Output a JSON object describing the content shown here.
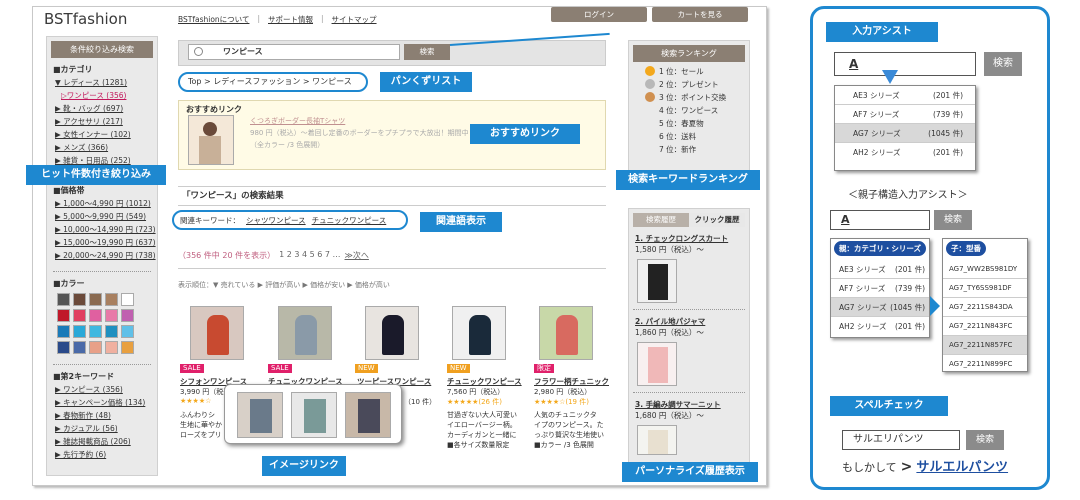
{
  "site": {
    "logo": "BSTfashion",
    "nav": [
      "BSTfashionについて",
      "サポート情報",
      "サイトマップ"
    ],
    "login": "ログイン",
    "cart": "カートを見る"
  },
  "left": {
    "filter_title": "条件絞り込み検索",
    "category_title": "■カテゴリ",
    "categories": [
      "▼ レディース (1281)",
      "▷ワンピース (356)",
      "▶ 靴・バッグ (697)",
      "▶ アクセサリ (217)",
      "▶ 女性インナー (102)",
      "▶ メンズ (366)",
      "▶ 雑貨・日用品 (252)"
    ],
    "price_title": "■価格帯",
    "prices": [
      "▶ 1,000〜4,990 円 (1012)",
      "▶ 5,000〜9,990 円 (549)",
      "▶ 10,000〜14,990 円 (723)",
      "▶ 15,000〜19,990 円 (637)",
      "▶ 20,000〜24,990 円 (738)"
    ],
    "color_title": "■カラー",
    "colors": [
      "#555",
      "#6b4a3a",
      "#8a6a50",
      "#a88060",
      "#fff",
      "#c0182a",
      "#e04060",
      "#e060a0",
      "#e87aa8",
      "#c060b0",
      "#1a7ab8",
      "#2aa8d8",
      "#40b8e0",
      "#2090c0",
      "#60c0e8",
      "#2a4a8a",
      "#4a6aa8",
      "#e8a088",
      "#f0b0a0",
      "#e8a040"
    ],
    "kw2_title": "■第2キーワード",
    "kw2": [
      "▶ ワンピース (356)",
      "▶ キャンペーン価格 (134)",
      "▶ 春物新作 (48)",
      "▶ カジュアル (56)",
      "▶ 雑誌掲載商品 (206)",
      "▶ 先行予約 (6)"
    ]
  },
  "search": {
    "query": "ワンピース",
    "button": "検索"
  },
  "breadcrumb": "Top > レディースファッション > ワンピース",
  "rec": {
    "title": "おすすめリンク",
    "link": "くつろぎボーダー長袖Tシャツ",
    "desc": "980 円（税込）〜着回し定番のボーダーをプチプラで大放出！期間中",
    "sub": "（全カラー /3 色展開）"
  },
  "results": {
    "title": "「ワンピース」の検索結果",
    "related_label": "関連キーワード：",
    "related": [
      "シャツワンピース",
      "チュニックワンピース"
    ],
    "count": "（356 件中 20 件を表示）",
    "pages": "1 2 3 4 5 6 7 …",
    "next": "≫次へ",
    "sort": "表示順位：▼ 売れている ▶ 評価が高い ▶ 価格が安い ▶ 価格が高い"
  },
  "products": [
    {
      "badge": "SALE",
      "name": "シフォンワンピース",
      "price": "3,990 円（税込）",
      "stars": "★★★★☆",
      "desc": [
        "ふんわりシ",
        "生地に華やか",
        "ローズをプリ"
      ]
    },
    {
      "badge": "SALE",
      "name": "チュニックワンピース",
      "price": "",
      "stars": "",
      "desc": []
    },
    {
      "badge": "NEW",
      "name": "ツーピースワンピース",
      "price": "（10 件）",
      "stars": "",
      "desc": []
    },
    {
      "badge": "NEW",
      "name": "チュニックワンピース",
      "price": "7,560 円（税込）",
      "stars": "★★★★★(26 件)",
      "desc": [
        "甘過ぎない大人可愛い",
        "イエローバージー柄。",
        "カーディガンと一緒に",
        "■各サイズ数量限定"
      ]
    },
    {
      "badge": "限定",
      "name": "フラワー柄チュニック",
      "price": "2,980 円（税込）",
      "stars": "★★★★☆(19 件)",
      "desc": [
        "人気のチュニックタ",
        "イプのワンピース。た",
        "っぷり贅沢な生地使い",
        "■カラー /3 色展開"
      ]
    }
  ],
  "ranking": {
    "title": "検索ランキング",
    "items": [
      "1 位：セール",
      "2 位：プレゼント",
      "3 位：ポイント交換",
      "4 位：ワンピース",
      "5 位：春夏物",
      "6 位：送料",
      "7 位：新作"
    ]
  },
  "history": {
    "tab1": "検索履歴",
    "tab2": "クリック履歴",
    "items": [
      {
        "name": "1. チェックロングスカート",
        "price": "1,580 円（税込）〜"
      },
      {
        "name": "2. パイル地パジャマ",
        "price": "1,860 円（税込）〜"
      },
      {
        "name": "3. 手編み調サマーニット",
        "price": "1,680 円（税込）〜"
      }
    ]
  },
  "callouts": {
    "breadcrumb": "パンくずリスト",
    "rec": "おすすめリンク",
    "hits": "ヒット件数付き絞り込み",
    "ranking": "検索キーワードランキング",
    "related": "関連語表示",
    "image": "イメージリンク",
    "history": "パーソナライズ履歴表示"
  },
  "assist": {
    "title": "入力アシスト",
    "input": "A",
    "button": "検索",
    "rows": [
      {
        "name": "AE3 シリーズ",
        "count": "(201 件)"
      },
      {
        "name": "AF7 シリーズ",
        "count": "(739 件)"
      },
      {
        "name": "AG7 シリーズ",
        "count": "(1045 件)"
      },
      {
        "name": "AH2 シリーズ",
        "count": "(201 件)"
      }
    ],
    "sub": "＜親子構造入力アシスト＞",
    "parent_label": "親：カテゴリ・シリーズ",
    "child_label": "子：型番",
    "parent_rows": [
      {
        "name": "AE3 シリーズ",
        "count": "(201 件)"
      },
      {
        "name": "AF7 シリーズ",
        "count": "(739 件)"
      },
      {
        "name": "AG7 シリーズ",
        "count": "(1045 件)"
      },
      {
        "name": "AH2 シリーズ",
        "count": "(201 件)"
      }
    ],
    "child_rows": [
      "AG7_WW2BS981DY",
      "AG7_TY6SS981DF",
      "AG7_2211S843DA",
      "AG7_2211N843FC",
      "AG7_2211N857FC",
      "AG7_2211N899FC"
    ]
  },
  "spell": {
    "title": "スペルチェック",
    "input": "サルエリパンツ",
    "button": "検索",
    "prefix": "もしかして",
    "arrow": ">",
    "suggestion": "サルエルパンツ"
  }
}
